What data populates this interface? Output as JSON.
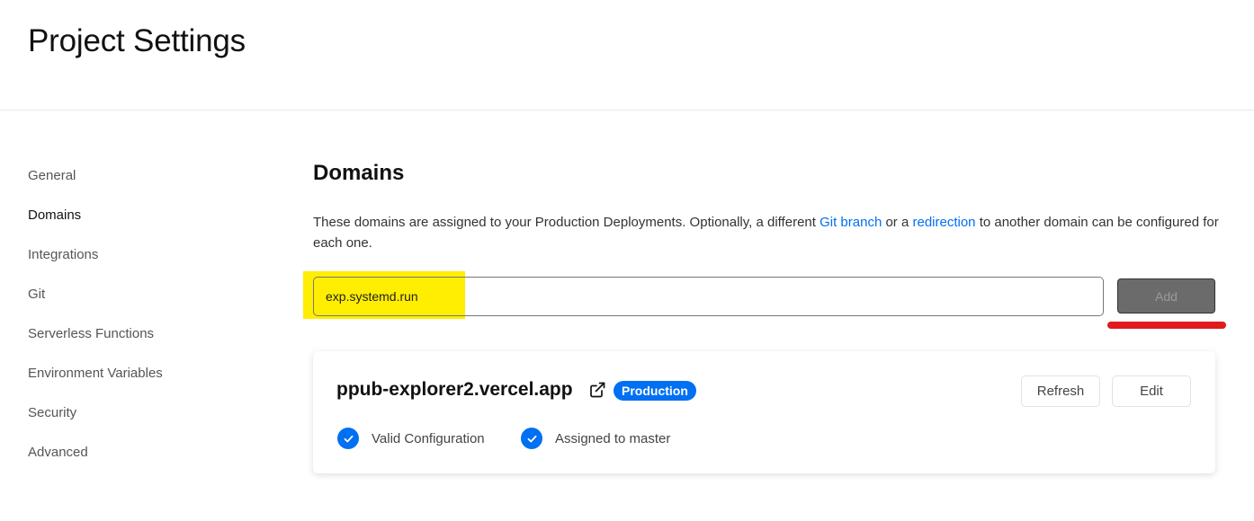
{
  "header": {
    "title": "Project Settings"
  },
  "sidebar": {
    "items": [
      {
        "label": "General",
        "active": false
      },
      {
        "label": "Domains",
        "active": true
      },
      {
        "label": "Integrations",
        "active": false
      },
      {
        "label": "Git",
        "active": false
      },
      {
        "label": "Serverless Functions",
        "active": false
      },
      {
        "label": "Environment Variables",
        "active": false
      },
      {
        "label": "Security",
        "active": false
      },
      {
        "label": "Advanced",
        "active": false
      }
    ]
  },
  "domains": {
    "title": "Domains",
    "description": {
      "part1": "These domains are assigned to your Production Deployments. Optionally, a different ",
      "link1": "Git branch",
      "part2": " or a ",
      "link2": "redirection",
      "part3": " to another domain can be configured for each one."
    },
    "input_value": "exp.systemd.run",
    "add_label": "Add"
  },
  "domain_card": {
    "name": "ppub-explorer2.vercel.app",
    "badge": "Production",
    "refresh_label": "Refresh",
    "edit_label": "Edit",
    "statuses": [
      {
        "label": "Valid Configuration",
        "icon": "check-circle-icon"
      },
      {
        "label": "Assigned to master",
        "icon": "check-circle-icon"
      }
    ]
  },
  "colors": {
    "accent": "#0070f3",
    "highlight": "#ffee00",
    "annotation": "#e01b1b"
  }
}
